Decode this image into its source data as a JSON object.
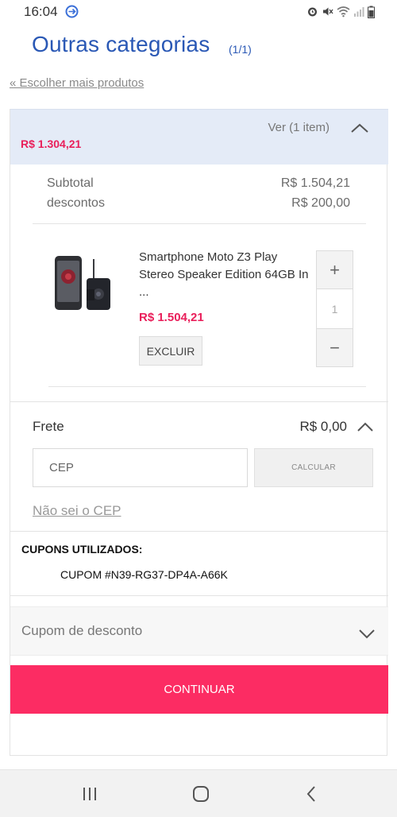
{
  "status_bar": {
    "time": "16:04",
    "left_icon": "data-saver-icon",
    "right_icons": [
      "alarm-icon",
      "mute-icon",
      "wifi-icon",
      "signal-icon",
      "battery-icon"
    ]
  },
  "header": {
    "title": "Outras categorias",
    "page_count": "(1/1)",
    "back_link": "« Escolher mais produtos"
  },
  "summary": {
    "total": "R$ 1.304,21",
    "view_label": "Ver (1 item)",
    "chevron_icon": "chevron-up-icon"
  },
  "totals": {
    "subtotal_label": "Subtotal",
    "subtotal_value": "R$ 1.504,21",
    "discount_label": "descontos",
    "discount_value": "R$ 200,00"
  },
  "product": {
    "name": "Smartphone Moto Z3 Play Stereo Speaker Edition 64GB In ...",
    "price": "R$ 1.504,21",
    "remove_label": "EXCLUIR",
    "quantity": "1",
    "plus_label": "+",
    "minus_label": "−"
  },
  "shipping": {
    "label": "Frete",
    "value": "R$ 0,00",
    "cep_placeholder": "CEP",
    "calculate_label": "CALCULAR",
    "no_cep_link": "Não sei o CEP"
  },
  "coupons": {
    "title": "CUPONS UTILIZADOS:",
    "code": "CUPOM #N39-RG37-DP4A-A66K",
    "discount_label": "Cupom de desconto"
  },
  "actions": {
    "continue_label": "CONTINUAR"
  },
  "nav_bar": {
    "icons": [
      "recent-apps-icon",
      "home-icon",
      "back-icon"
    ]
  },
  "colors": {
    "title_blue": "#2a58b5",
    "price_pink": "#e91e5a",
    "continue_button": "#fc2c63",
    "summary_background": "#e4ebf7"
  }
}
